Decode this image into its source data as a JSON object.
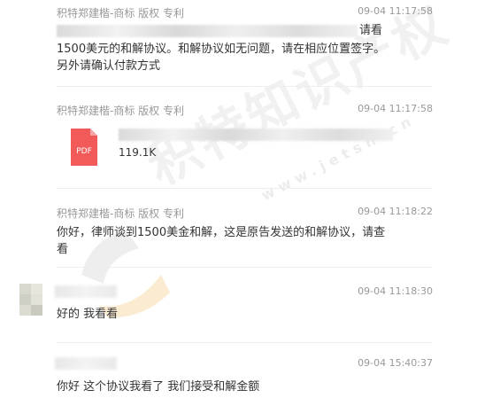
{
  "messages": [
    {
      "sender": "积特郑建楷-商标 版权 专利",
      "time": "09-04 11:17:58",
      "text_tail": "请看",
      "line2": "1500美元的和解协议。和解协议如无问题，请在相应位置签字。",
      "line3": "另外请确认付款方式"
    },
    {
      "sender": "积特郑建楷-商标 版权 专利",
      "time": "09-04 11:17:58",
      "file": {
        "type_label": "PDF",
        "size": "119.1K"
      }
    },
    {
      "sender": "积特郑建楷-商标 版权 专利",
      "time": "09-04 11:18:22",
      "line1": "你好，律师谈到1500美金和解，这是原告发送的和解协议，请查",
      "line2": "看"
    },
    {
      "time": "09-04 11:18:30",
      "text": "好的 我看看"
    },
    {
      "time": "09-04 15:40:37",
      "text": "你好 这个协议我看了 我们接受和解金额"
    }
  ],
  "watermark": {
    "text": "积特知识产权",
    "url": "www.jetsn.cn"
  },
  "colors": {
    "pdf_red": "#f25a5a",
    "meta_gray": "#999999",
    "text": "#333333"
  }
}
